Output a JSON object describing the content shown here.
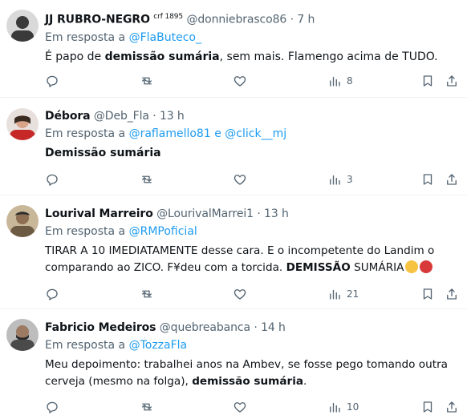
{
  "tweets": [
    {
      "name": "JJ RUBRO-NEGRO",
      "badge": "crf 1895",
      "handle": "@donniebrasco86",
      "sep": "·",
      "time": "7 h",
      "reply_prefix": "Em resposta a",
      "mention1": "@FlaButeco_",
      "text_a": "É papo de ",
      "text_b": "demissão sumária",
      "text_c": ", sem mais. Flamengo acima de TUDO.",
      "views": "8",
      "avatar_color": "#3a3a3a"
    },
    {
      "name": "Débora",
      "handle": "@Deb_Fla",
      "sep": "·",
      "time": "13 h",
      "reply_prefix": "Em resposta a",
      "mention1": "@raflamello81",
      "joiner": "e",
      "mention2": "@click__mj",
      "text_b": "Demissão sumária",
      "views": "3",
      "avatar_color": "#c62828"
    },
    {
      "name": "Lourival Marreiro",
      "handle": "@LourivalMarrei1",
      "sep": "·",
      "time": "13 h",
      "reply_prefix": "Em resposta a",
      "mention1": "@RMPoficial",
      "line1": "TIRAR A 10 IMEDIATAMENTE desse cara. E o incompetente do Landim o",
      "line2_a": "comparando ao ZICO. F¥deu com a torcida. ",
      "line2_b": "DEMISSÃO",
      "line2_c": " SUMÁRIA",
      "views": "21",
      "avatar_color": "#6d5a43"
    },
    {
      "name": "Fabricio Medeiros",
      "handle": "@quebreabanca",
      "sep": "·",
      "time": "14 h",
      "reply_prefix": "Em resposta a",
      "mention1": "@TozzaFla",
      "line1": "Meu depoimento: trabalhei anos na Ambev, se fosse pego tomando outra",
      "line2_a": "cerveja (mesmo na folga), ",
      "line2_b": "demissão sumária",
      "line2_c": ".",
      "views": "10",
      "avatar_color": "#4a4a4a"
    }
  ],
  "icons": {
    "reply": "reply-icon",
    "retweet": "retweet-icon",
    "like": "like-icon",
    "views": "views-icon",
    "bookmark": "bookmark-icon",
    "share": "share-icon"
  },
  "colors": {
    "link": "#1d9bf0",
    "secondary": "#536471",
    "primary": "#0f1419",
    "divider": "#eff3f4"
  }
}
